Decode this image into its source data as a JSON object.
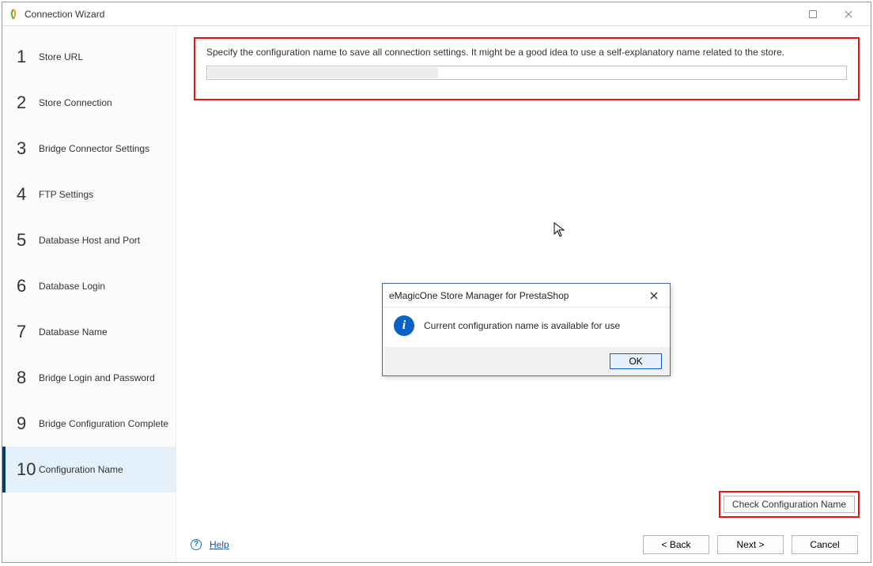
{
  "window": {
    "title": "Connection Wizard"
  },
  "sidebar": {
    "steps": [
      {
        "num": "1",
        "label": "Store URL"
      },
      {
        "num": "2",
        "label": "Store Connection"
      },
      {
        "num": "3",
        "label": "Bridge Connector Settings"
      },
      {
        "num": "4",
        "label": "FTP Settings"
      },
      {
        "num": "5",
        "label": "Database Host and Port"
      },
      {
        "num": "6",
        "label": "Database Login"
      },
      {
        "num": "7",
        "label": "Database Name"
      },
      {
        "num": "8",
        "label": "Bridge Login and Password"
      },
      {
        "num": "9",
        "label": "Bridge Configuration Complete"
      },
      {
        "num": "10",
        "label": "Configuration Name"
      }
    ],
    "active_index": 9
  },
  "main": {
    "instruction": "Specify the configuration name to save all connection settings. It might be a good idea to use a self-explanatory name related to the store.",
    "config_name_value": "",
    "check_button": "Check Configuration Name"
  },
  "footer": {
    "help": "Help",
    "back": "< Back",
    "next": "Next >",
    "cancel": "Cancel"
  },
  "dialog": {
    "title": "eMagicOne Store Manager for PrestaShop",
    "message": "Current configuration name is available for use",
    "ok": "OK"
  }
}
